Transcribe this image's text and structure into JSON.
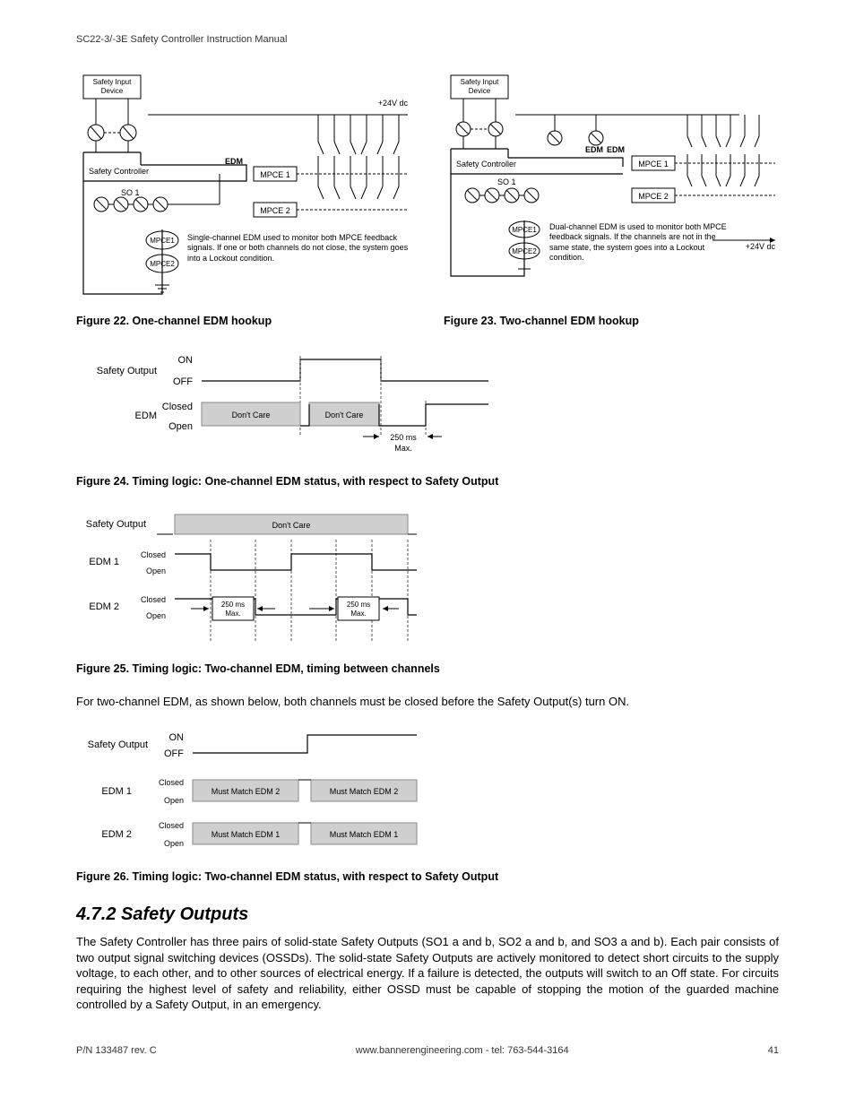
{
  "header": "SC22-3/-3E Safety Controller Instruction Manual",
  "fig22": {
    "caption": "Figure 22. One-channel EDM hookup",
    "labels": {
      "sid": "Safety Input\nDevice",
      "v24": "+24V dc",
      "edm": "EDM",
      "sc": "Safety Controller",
      "so1": "SO 1",
      "mpce1": "MPCE 1",
      "mpce2": "MPCE 2",
      "mpce1s": "MPCE1",
      "mpce2s": "MPCE2",
      "note": "Single-channel EDM used to monitor both MPCE feedback signals. If one or both channels do not close, the system goes into a Lockout condition."
    }
  },
  "fig23": {
    "caption": "Figure 23. Two-channel EDM hookup",
    "labels": {
      "sid": "Safety Input\nDevice",
      "v24": "+24V dc",
      "edm1": "EDM",
      "edm2": "EDM",
      "sc": "Safety Controller",
      "so1": "SO 1",
      "mpce1": "MPCE 1",
      "mpce2": "MPCE 2",
      "mpce1s": "MPCE1",
      "mpce2s": "MPCE2",
      "note": "Dual-channel EDM is used to monitor both MPCE feedback signals. If the channels are not in the same state, the system goes into a Lockout condition."
    }
  },
  "fig24": {
    "caption": "Figure 24. Timing logic: One-channel EDM status, with respect to Safety Output",
    "so": "Safety Output",
    "on": "ON",
    "off": "OFF",
    "edm": "EDM",
    "closed": "Closed",
    "open": "Open",
    "dc": "Don't Care",
    "t": "250 ms\nMax."
  },
  "fig25": {
    "caption": "Figure 25. Timing logic: Two-channel EDM, timing between channels",
    "so": "Safety Output",
    "e1": "EDM 1",
    "e2": "EDM 2",
    "closed": "Closed",
    "open": "Open",
    "dc": "Don't Care",
    "t": "250 ms\nMax."
  },
  "intro26": "For two-channel EDM, as shown below, both channels must be closed before the Safety Output(s) turn ON.",
  "fig26": {
    "caption": "Figure 26. Timing logic: Two-channel EDM status, with respect to Safety Output",
    "so": "Safety Output",
    "on": "ON",
    "off": "OFF",
    "e1": "EDM 1",
    "e2": "EDM 2",
    "closed": "Closed",
    "open": "Open",
    "m2": "Must Match EDM 2",
    "m1": "Must Match EDM 1"
  },
  "section": {
    "title": "4.7.2 Safety Outputs",
    "body": "The Safety Controller has three pairs of solid-state Safety Outputs (SO1 a and b, SO2 a and b, and SO3 a and b). Each pair consists of two output signal switching devices (OSSDs). The solid-state Safety Outputs are actively monitored to detect short circuits to the supply voltage, to each other, and to other sources of electrical energy. If a failure is detected, the outputs will switch to an Off state. For circuits requiring the highest level of safety and reliability, either OSSD must be capable of stopping the motion of the guarded machine controlled by a Safety Output, in an emergency."
  },
  "footer": {
    "left": "P/N 133487 rev. C",
    "center": "www.bannerengineering.com - tel: 763-544-3164",
    "right": "41"
  }
}
